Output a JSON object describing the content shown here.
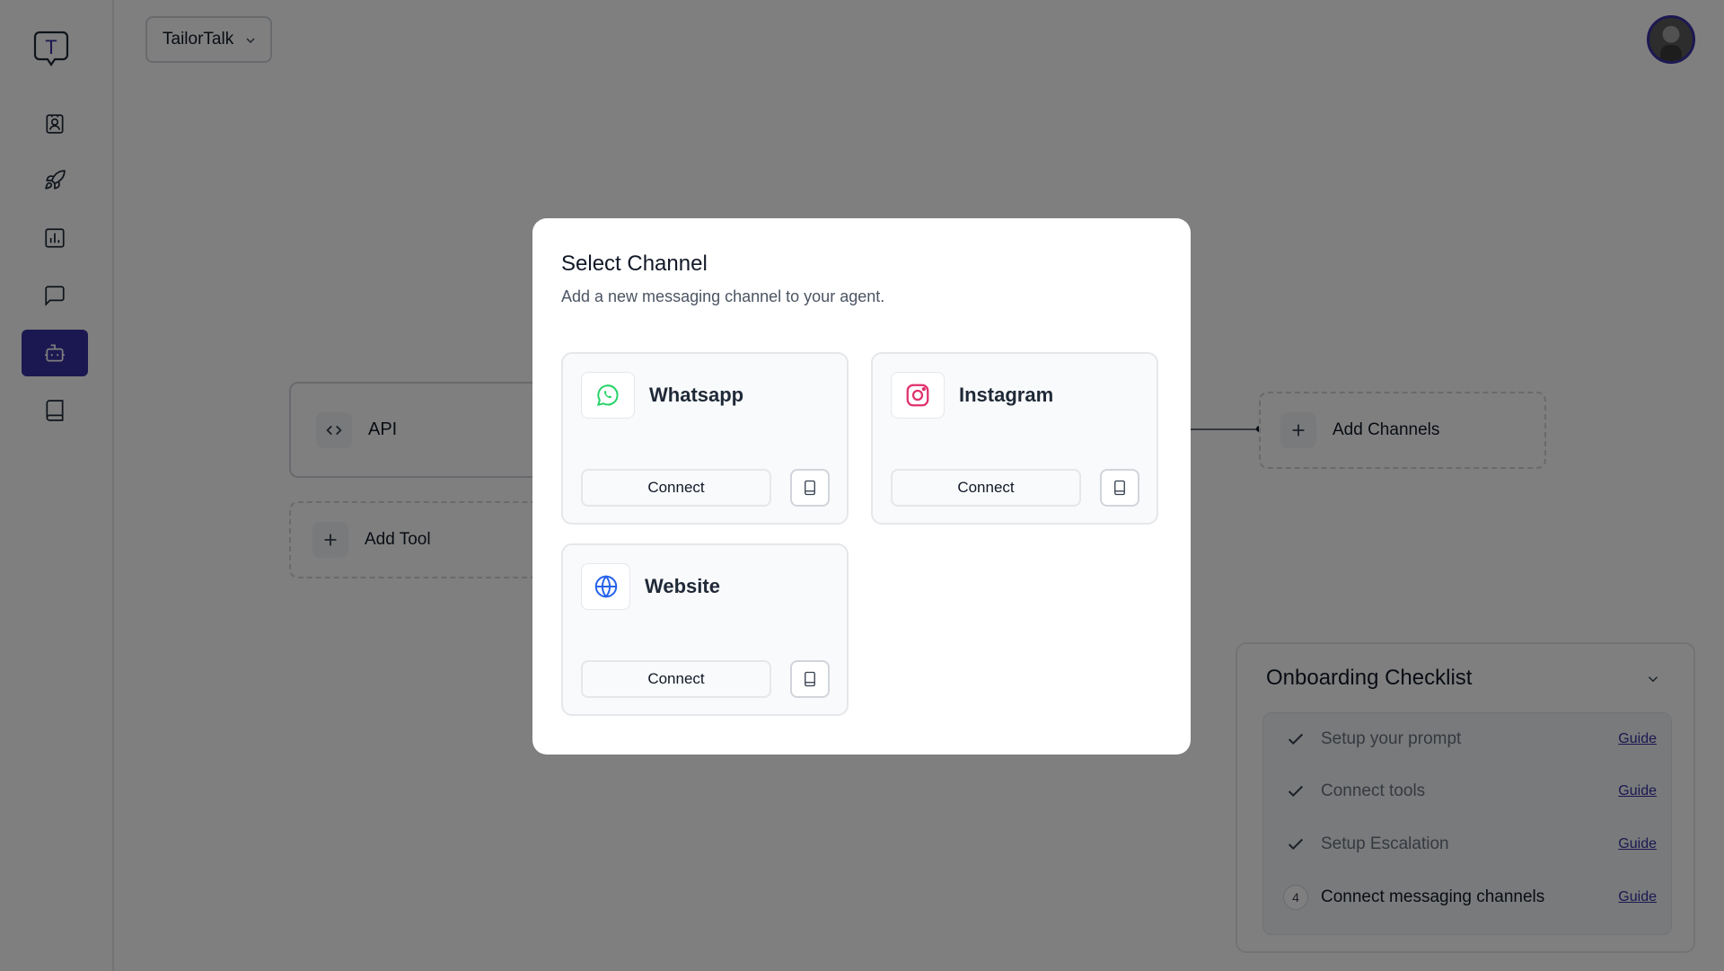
{
  "header": {
    "workspace_label": "TailorTalk"
  },
  "sidebar": {
    "logo_letter": "T",
    "items": [
      {
        "icon": "contact-icon",
        "active": false
      },
      {
        "icon": "rocket-icon",
        "active": false
      },
      {
        "icon": "analytics-icon",
        "active": false
      },
      {
        "icon": "chat-icon",
        "active": false
      },
      {
        "icon": "bot-icon",
        "active": true
      },
      {
        "icon": "book-icon",
        "active": false
      }
    ]
  },
  "canvas": {
    "api_node_label": "API",
    "add_tool_label": "Add Tool",
    "add_channels_label": "Add Channels"
  },
  "checklist": {
    "title": "Onboarding Checklist",
    "items": [
      {
        "label": "Setup your prompt",
        "done": true,
        "guide": "Guide"
      },
      {
        "label": "Connect tools",
        "done": true,
        "guide": "Guide"
      },
      {
        "label": "Setup Escalation",
        "done": true,
        "guide": "Guide"
      },
      {
        "label": "Connect messaging channels",
        "done": false,
        "step": "4",
        "guide": "Guide"
      }
    ]
  },
  "modal": {
    "title": "Select Channel",
    "subtitle": "Add a new messaging channel to your agent.",
    "channels": [
      {
        "name": "Whatsapp",
        "icon": "whatsapp-icon",
        "color": "#25d366",
        "button": "Connect"
      },
      {
        "name": "Instagram",
        "icon": "instagram-icon",
        "color": "#e1306c",
        "button": "Connect"
      },
      {
        "name": "Website",
        "icon": "globe-icon",
        "color": "#2563eb",
        "button": "Connect"
      }
    ]
  },
  "colors": {
    "accent": "#3730a3",
    "overlay": "rgba(0,0,0,0.5)"
  }
}
